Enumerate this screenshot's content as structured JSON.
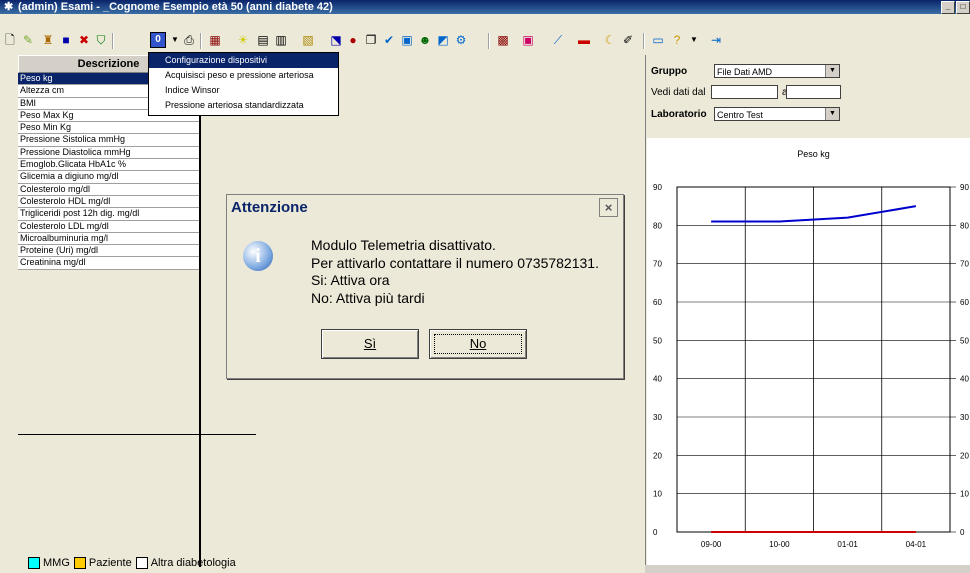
{
  "window": {
    "title": "(admin) Esami - _Cognome Esempio età 50 (anni diabete 42)",
    "controls": [
      "_",
      "□"
    ]
  },
  "toolbar": {
    "icons": [
      "new-icon",
      "user-icon",
      "import-icon",
      "save-icon",
      "delete-icon",
      "shield-icon",
      "telemetry-icon",
      "dropdown-icon",
      "print-icon",
      "grid-icon",
      "lightbulb-icon",
      "calendar-icon",
      "chart-icon",
      "list-icon",
      "graph-icon",
      "pill-icon",
      "pages-icon",
      "check-icon",
      "report-icon",
      "people-icon",
      "chat-icon",
      "settings-icon",
      "table-icon",
      "window-icon",
      "line-icon",
      "flag-icon",
      "moon-icon",
      "note-icon",
      "monitor-icon",
      "help-icon",
      "dropdown-icon",
      "exit-icon"
    ]
  },
  "table": {
    "header": "Descrizione",
    "rows": [
      "Peso kg",
      "Altezza cm",
      "BMI",
      "Peso Max Kg",
      "Peso Min Kg",
      "Pressione Sistolica mmHg",
      "Pressione Diastolica mmHg",
      "Emoglob.Glicata HbA1c %",
      "Glicemia a digiuno mg/dl",
      "Colesterolo mg/dl",
      "Colesterolo HDL mg/dl",
      "Trigliceridi post 12h dig. mg/dl",
      "Colesterolo LDL mg/dl",
      "Microalbuminuria mg/l",
      "Proteine (Uri) mg/dl",
      "Creatinina mg/dl"
    ],
    "selected_index": 0
  },
  "menu": {
    "items": [
      "Configurazione dispositivi",
      "Acquisisci peso e pressione arteriosa",
      "Indice Winsor",
      "Pressione arteriosa standardizzata"
    ],
    "highlighted_index": 0
  },
  "filters": {
    "gruppo_label": "Gruppo",
    "gruppo_value": "File Dati AMD",
    "vedi_label": "Vedi dati dal",
    "vedi_from": "",
    "al_label": "al",
    "vedi_to": "",
    "laboratorio_label": "Laboratorio",
    "laboratorio_value": "Centro Test"
  },
  "legend": {
    "items": [
      {
        "label": "MMG",
        "color": "#00ffff"
      },
      {
        "label": "Paziente",
        "color": "#ffcc00"
      },
      {
        "label": "Altra diabetologia",
        "color": "#ffffff"
      }
    ]
  },
  "dialog": {
    "title": "Attenzione",
    "close_symbol": "×",
    "icon": "info-icon",
    "message_lines": [
      "Modulo Telemetria disattivato.",
      "Per attivarlo contattare il numero 0735782131.",
      "Si: Attiva ora",
      "No: Attiva più tardi"
    ],
    "yes_label": "Sì",
    "no_label": "No"
  },
  "chart_data": {
    "type": "line",
    "title": "Peso kg",
    "categories": [
      "09-00",
      "10-00",
      "01-01",
      "04-01"
    ],
    "ylim": [
      0,
      90
    ],
    "yticks": [
      0,
      10,
      20,
      30,
      40,
      50,
      60,
      70,
      80,
      90
    ],
    "grid": true,
    "series": [
      {
        "color": "#0000cc",
        "values": [
          81,
          81,
          82,
          85
        ]
      },
      {
        "color": "#cc0000",
        "values": [
          0,
          0,
          0,
          0
        ]
      }
    ]
  },
  "colors": {
    "titlebar": "#0a246a",
    "selection": "#0a246a",
    "background": "#ece9d8"
  }
}
